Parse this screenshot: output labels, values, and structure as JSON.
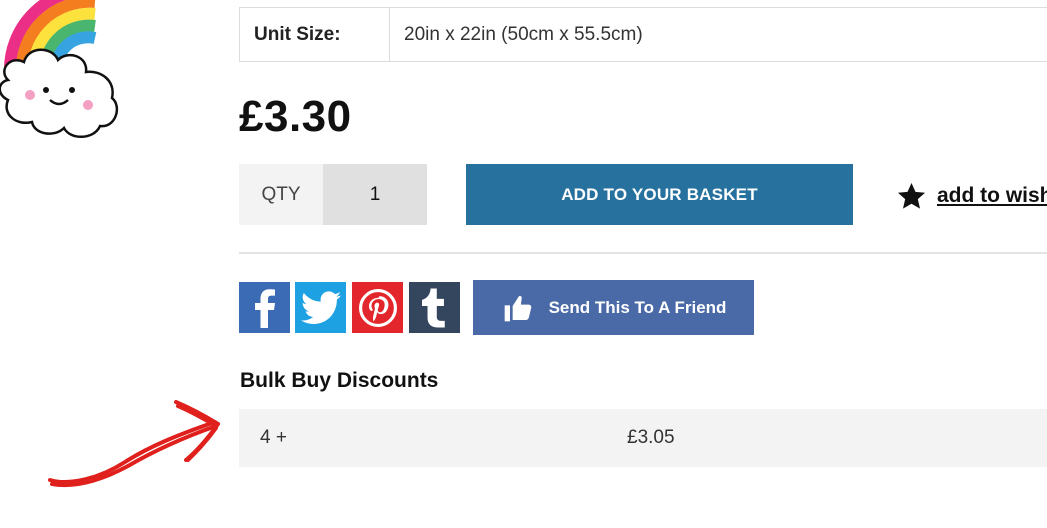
{
  "product": {
    "unit_size_label": "Unit Size:",
    "unit_size_value": "20in x 22in (50cm x 55.5cm)",
    "price": "£3.30"
  },
  "purchase": {
    "qty_label": "QTY",
    "qty_value": "1",
    "add_button_label": "ADD TO YOUR BASKET",
    "wishlist_label": "add to wish"
  },
  "share": {
    "icons": [
      "facebook-icon",
      "twitter-icon",
      "pinterest-icon",
      "tumblr-icon"
    ],
    "send_friend_label": "Send This To A Friend"
  },
  "bulk": {
    "title": "Bulk Buy Discounts",
    "rows": [
      {
        "qty": "4 +",
        "price": "£3.05"
      }
    ]
  },
  "colors": {
    "add_button": "#27719f",
    "facebook": "#3b6bb5",
    "twitter": "#1da1e2",
    "pinterest": "#e3262c",
    "tumblr": "#34465d",
    "send_friend": "#4a6aa7",
    "annotation_arrow": "#e0201c"
  }
}
